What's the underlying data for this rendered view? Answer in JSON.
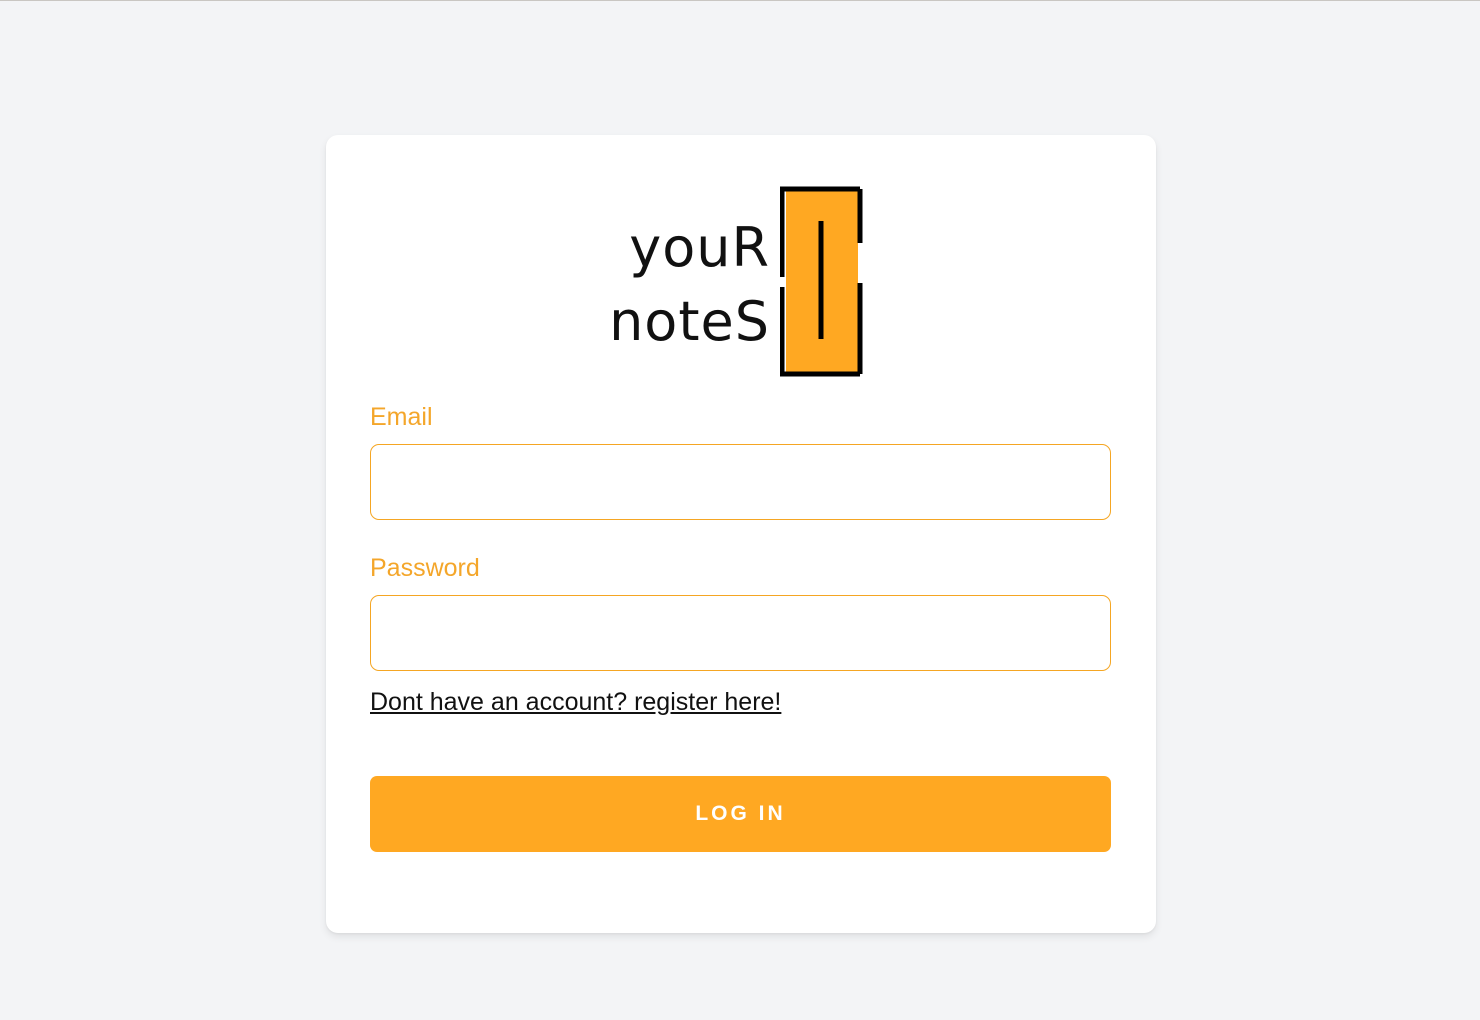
{
  "logo": {
    "line1": "youR",
    "line2": "noteS",
    "icon": "notebook-bracket-logo"
  },
  "form": {
    "email_label": "Email",
    "email_value": "",
    "password_label": "Password",
    "password_value": "",
    "register_link": "Dont have an account? register here!",
    "login_label": "LOG IN"
  },
  "colors": {
    "accent": "#ffa822",
    "label": "#f4a62a",
    "background": "#f3f4f6",
    "card": "#ffffff"
  }
}
